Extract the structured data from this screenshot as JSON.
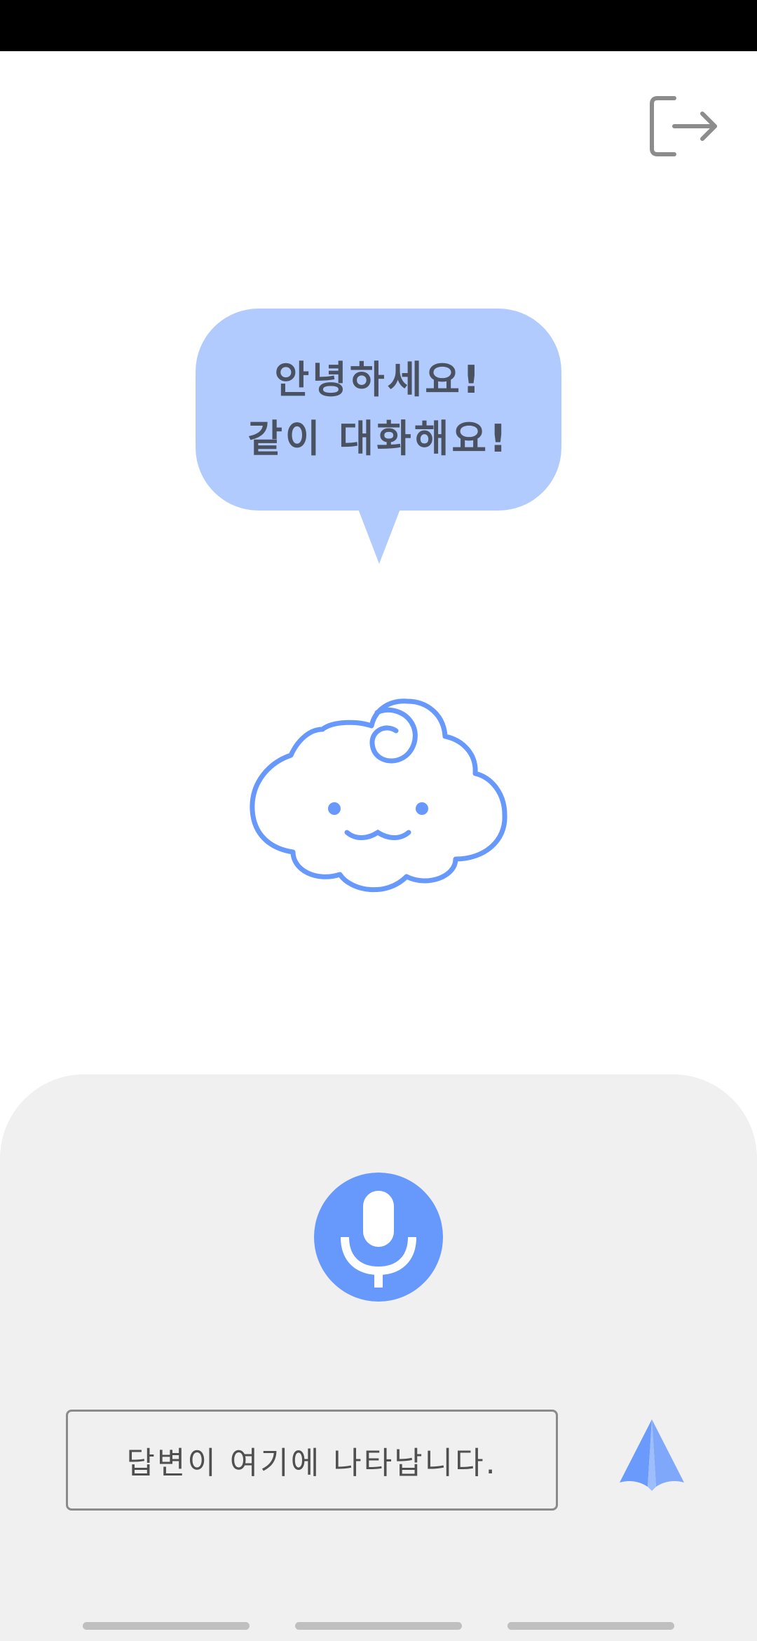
{
  "greeting": {
    "line1": "안녕하세요!",
    "line2": "같이 대화해요!"
  },
  "answer": {
    "placeholder": "답변이 여기에 나타납니다."
  },
  "icons": {
    "exit": "logout-icon",
    "mic": "microphone-icon",
    "send": "send-icon",
    "mascot": "cloud-mascot"
  },
  "colors": {
    "accent": "#6799fd",
    "bubble": "#b2cbfe",
    "panel": "#f0f0f0",
    "text": "#4a5262"
  }
}
